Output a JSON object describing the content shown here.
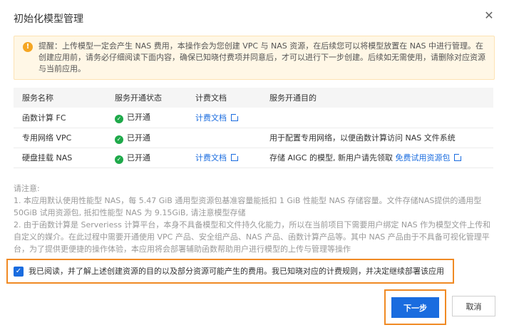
{
  "dialog": {
    "title": "初始化模型管理",
    "close_icon": "close-icon"
  },
  "alert": {
    "icon": "warning-icon",
    "text": "提醒：上传模型一定会产生 NAS 费用，本操作会为您创建 VPC 与 NAS 资源，在后续您可以将模型放置在 NAS 中进行管理。在创建应用前，请务必仔细阅读下面内容，确保已知晓付费项并同意后，才可以进行下一步创建。后续如无需使用，请删除对应资源与当前应用。"
  },
  "table": {
    "headers": [
      "服务名称",
      "服务开通状态",
      "计费文档",
      "服务开通目的"
    ],
    "rows": [
      {
        "name": "函数计算 FC",
        "status": "已开通",
        "doc": "计费文档",
        "purpose": "",
        "purpose_link": ""
      },
      {
        "name": "专用网络 VPC",
        "status": "已开通",
        "doc": "",
        "purpose": "用于配置专用网络，以便函数计算访问 NAS 文件系统",
        "purpose_link": ""
      },
      {
        "name": "硬盘挂载 NAS",
        "status": "已开通",
        "doc": "计费文档",
        "purpose": "存储 AIGC 的模型, 新用户请先领取",
        "purpose_link": "免费试用资源包"
      }
    ]
  },
  "notes": {
    "heading": "请注意:",
    "items": [
      "1. 本应用默认使用性能型 NAS，每 5.47 GiB 通用型资源包基准容量能抵扣 1 GiB 性能型 NAS 存储容量。文件存储NAS提供的通用型 50GiB 试用资源包, 抵扣性能型 NAS 为 9.15GiB, 请注意模型存储",
      "2. 由于函数计算是 Serveriess 计算平台，本身不具备模型和文件持久化能力，所以在当前项目下需要用户绑定 NAS 作为模型文件上传和自定义的媒介。在此过程中需要开通使用 VPC 产品、安全组产品、NAS 产品、函数计算产品等。其中 NAS 产品由于不具备可视化管理平台，为了提供更便捷的操作体验，本应用将会部署辅助函数帮助用户进行模型的上传与管理等操作"
    ]
  },
  "agreement": {
    "checked": true,
    "text": "我已阅读，并了解上述创建资源的目的以及部分资源可能产生的费用。我已知晓对应的计费规则，并决定继续部署该应用"
  },
  "footer": {
    "next_label": "下一步",
    "cancel_label": "取消"
  },
  "colors": {
    "primary": "#1a6cdf",
    "highlight_border": "#f08a24",
    "success": "#1fa94a",
    "alert_bg": "#fff7e6"
  }
}
